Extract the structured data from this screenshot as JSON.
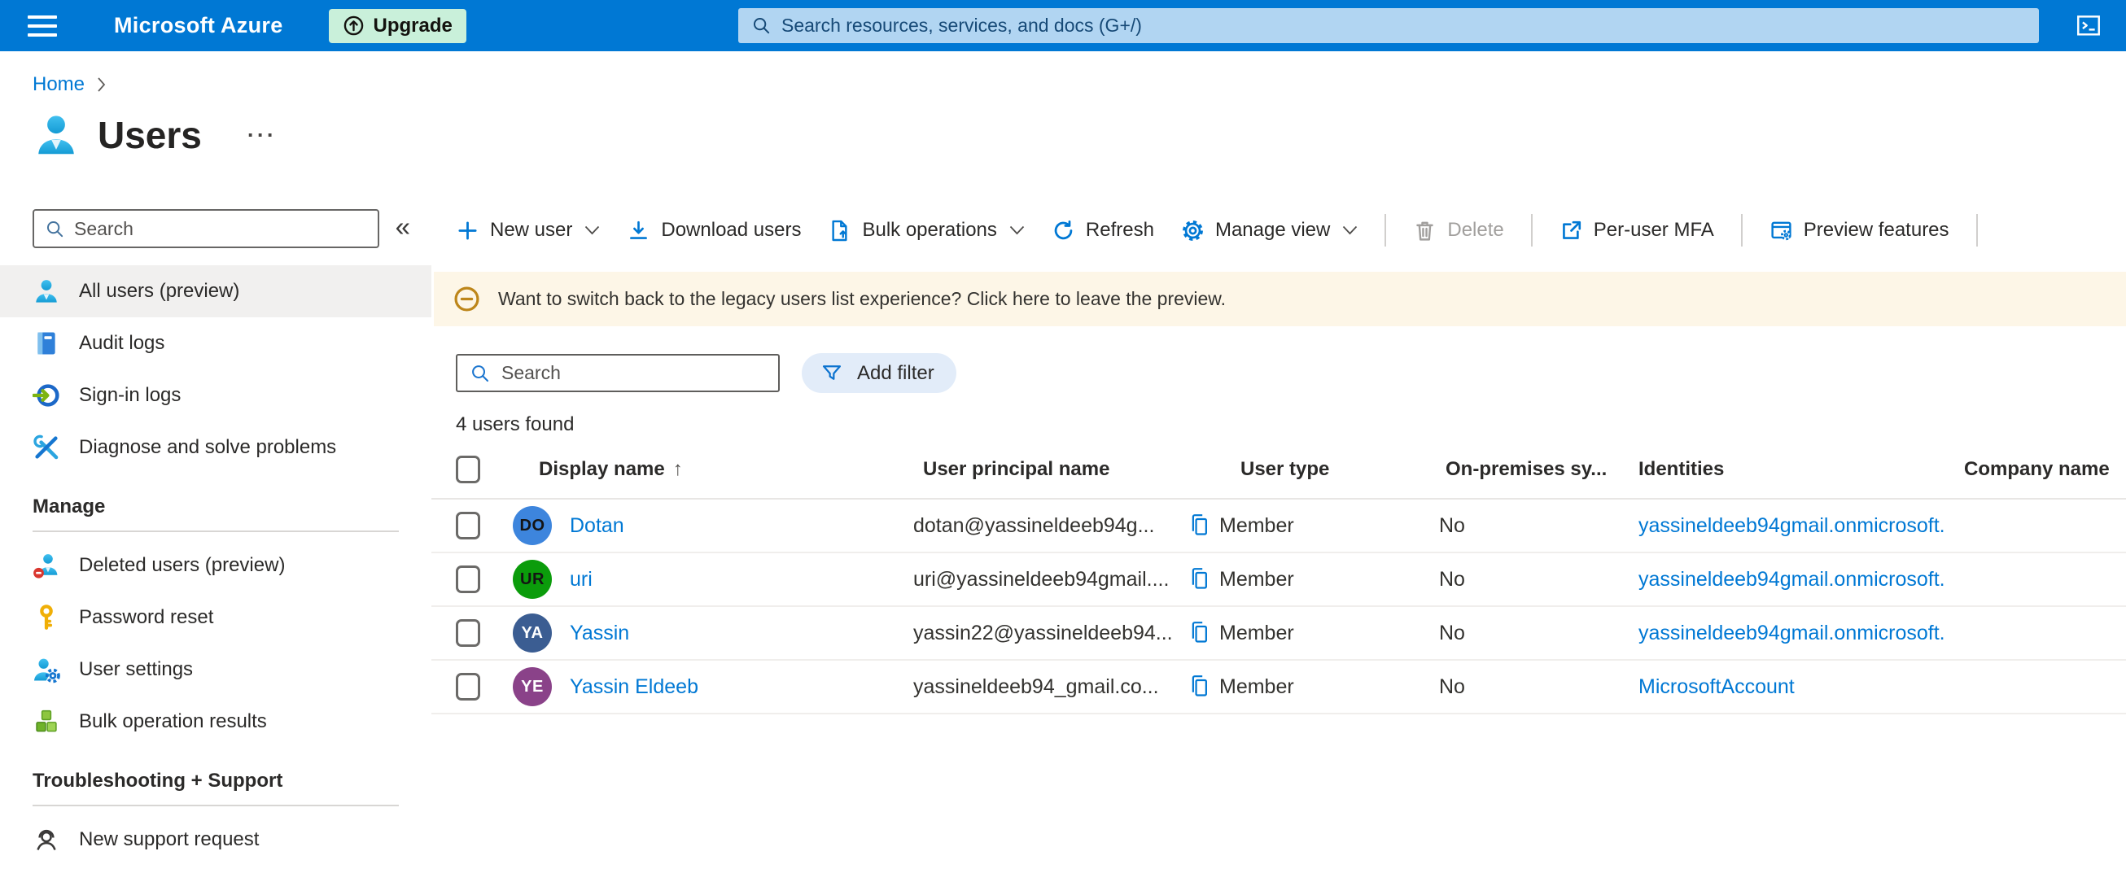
{
  "colors": {
    "accent": "#0078d4",
    "topbar_bg": "#0078d4",
    "upgrade_bg": "#c9f0da",
    "banner_bg": "#fdf6e7",
    "selected_nav_bg": "#f1f0ef",
    "link": "#0078d4",
    "disabled_text": "#a19f9d"
  },
  "topbar": {
    "product": "Microsoft Azure",
    "upgrade_label": "Upgrade",
    "search_placeholder": "Search resources, services, and docs (G+/)"
  },
  "breadcrumb": {
    "home": "Home"
  },
  "page": {
    "title": "Users",
    "menu_ellipsis": "···"
  },
  "sidebar": {
    "search_placeholder": "Search",
    "collapse_glyph": "«",
    "nav": [
      {
        "label": "All users (preview)",
        "icon": "users-icon",
        "selected": true
      },
      {
        "label": "Audit logs",
        "icon": "audit-logs-icon",
        "selected": false
      },
      {
        "label": "Sign-in logs",
        "icon": "sign-in-logs-icon",
        "selected": false
      },
      {
        "label": "Diagnose and solve problems",
        "icon": "diagnose-icon",
        "selected": false
      }
    ],
    "manage": {
      "header": "Manage",
      "items": [
        {
          "label": "Deleted users (preview)",
          "icon": "deleted-users-icon"
        },
        {
          "label": "Password reset",
          "icon": "password-reset-icon"
        },
        {
          "label": "User settings",
          "icon": "user-settings-icon"
        },
        {
          "label": "Bulk operation results",
          "icon": "bulk-results-icon"
        }
      ]
    },
    "support": {
      "header": "Troubleshooting + Support",
      "items": [
        {
          "label": "New support request",
          "icon": "support-request-icon"
        }
      ]
    }
  },
  "toolbar": {
    "new_user": "New user",
    "download_users": "Download users",
    "bulk_operations": "Bulk operations",
    "refresh": "Refresh",
    "manage_view": "Manage view",
    "delete": "Delete",
    "per_user_mfa": "Per-user MFA",
    "preview_features": "Preview features"
  },
  "banner": {
    "message": "Want to switch back to the legacy users list experience? Click here to leave the preview."
  },
  "filters": {
    "search_placeholder": "Search",
    "add_filter": "Add filter"
  },
  "results_count": "4 users found",
  "table": {
    "sort_glyph": "↑",
    "columns": {
      "display_name": "Display name",
      "user_principal_name": "User principal name",
      "user_type": "User type",
      "on_premises_sync": "On-premises sy...",
      "identities": "Identities",
      "company_name": "Company name"
    },
    "rows": [
      {
        "initials": "DO",
        "avatar_bg": "#3d85dd",
        "avatar_fg": "#141414",
        "display_name": "Dotan",
        "user_principal_name": "dotan@yassineldeeb94g...",
        "user_type": "Member",
        "on_premises_sync": "No",
        "identities": "yassineldeeb94gmail.onmicrosoft."
      },
      {
        "initials": "UR",
        "avatar_bg": "#0b9c0b",
        "avatar_fg": "#141414",
        "display_name": "uri",
        "user_principal_name": "uri@yassineldeeb94gmail....",
        "user_type": "Member",
        "on_premises_sync": "No",
        "identities": "yassineldeeb94gmail.onmicrosoft."
      },
      {
        "initials": "YA",
        "avatar_bg": "#3b5d92",
        "avatar_fg": "#ffffff",
        "display_name": "Yassin",
        "user_principal_name": "yassin22@yassineldeeb94...",
        "user_type": "Member",
        "on_premises_sync": "No",
        "identities": "yassineldeeb94gmail.onmicrosoft."
      },
      {
        "initials": "YE",
        "avatar_bg": "#8a4289",
        "avatar_fg": "#ffffff",
        "display_name": "Yassin Eldeeb",
        "user_principal_name": "yassineldeeb94_gmail.co...",
        "user_type": "Member",
        "on_premises_sync": "No",
        "identities": "MicrosoftAccount"
      }
    ]
  }
}
